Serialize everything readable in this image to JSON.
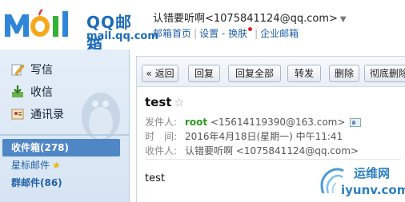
{
  "header": {
    "logo_text": "QQ邮箱",
    "logo_sub": "mail.qq.com",
    "account": "认错要听啊<1075841124@qq.com>",
    "links": {
      "home": "邮箱首页",
      "settings": "设置",
      "dash": "-",
      "skin": "换肤",
      "enterprise": "企业邮箱"
    }
  },
  "sidebar": {
    "compose": "写信",
    "receive": "收信",
    "contacts": "通讯录",
    "folders": {
      "inbox": "收件箱(278)",
      "starred": "星标邮件",
      "group": "群邮件(86)"
    }
  },
  "toolbar": {
    "back": "« 返回",
    "reply": "回复",
    "reply_all": "回复全部",
    "forward": "转发",
    "delete": "删除",
    "perm_delete": "彻底删除"
  },
  "mail": {
    "subject": "test",
    "from_label": "发件人:",
    "from_name": "root",
    "from_addr": "<15614119390@163.com>",
    "time_label": "时　间:",
    "time_value": "2016年4月18日(星期一) 中午11:41",
    "to_label": "收件人:",
    "to_value": "认错要听啊 <1075841124@qq.com>",
    "body": "test"
  },
  "watermark": {
    "name": "运维网",
    "url": "iyunv.com"
  },
  "colors": {
    "brand_blue": "#1c6bb8",
    "active_folder": "#4f86c6",
    "sender_green": "#2a9a1e"
  }
}
